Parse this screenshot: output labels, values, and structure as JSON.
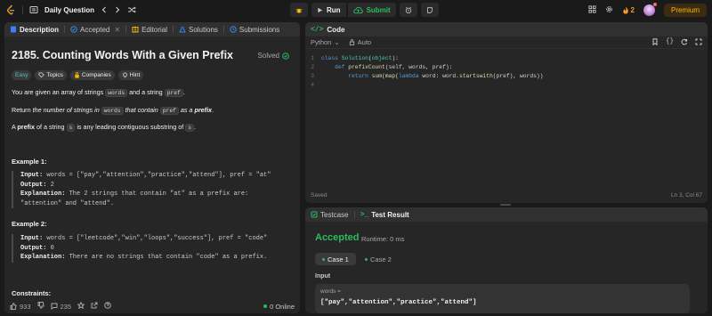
{
  "topbar": {
    "title": "Daily Question",
    "run_label": "Run",
    "submit_label": "Submit",
    "streak": "2",
    "premium_label": "Premium"
  },
  "left_tabs": {
    "description": "Description",
    "accepted": "Accepted",
    "editorial": "Editorial",
    "solutions": "Solutions",
    "submissions": "Submissions"
  },
  "problem": {
    "title": "2185. Counting Words With a Given Prefix",
    "status": "Solved",
    "tags": [
      "Easy",
      "Topics",
      "Companies",
      "Hint"
    ],
    "p1_a": "You are given an array of strings",
    "p1_code1": "words",
    "p1_b": "and a string",
    "p1_code2": "pref",
    "p1_c": ".",
    "p2_a": "Return",
    "p2_em": "the number of strings in",
    "p2_code1": "words",
    "p2_em2": "that contain",
    "p2_code2": "pref",
    "p2_em3": "as a",
    "p2_strong": "prefix",
    "p2_c": ".",
    "p3_a": "A",
    "p3_strong": "prefix",
    "p3_b": "of a string",
    "p3_code1": "s",
    "p3_c": "is any leading contiguous substring of",
    "p3_code2": "s",
    "p3_d": ".",
    "example1_title": "Example 1:",
    "example1_input": "words = [\"pay\",\"attention\",\"practice\",\"attend\"], pref = \"at\"",
    "example1_output": "2",
    "example1_explanation_1": "The 2 strings that contain \"at\" as a prefix are:",
    "example1_explanation_2": "\"attention\" and \"attend\".",
    "example2_title": "Example 2:",
    "example2_input": "words = [\"leetcode\",\"win\",\"loops\",\"success\"], pref = \"code\"",
    "example2_output": "0",
    "example2_explanation": "There are no strings that contain \"code\" as a prefix.",
    "constraints_title": "Constraints:"
  },
  "footer": {
    "likes": "933",
    "comments": "235",
    "online": "0 Online"
  },
  "code_panel": {
    "title": "Code",
    "language": "Python",
    "auto": "Auto",
    "lines": [
      "class Solution(object):",
      "    def prefixCount(self, words, pref):",
      "        return sum(map(lambda word: word.startswith(pref), words))",
      ""
    ],
    "line_numbers": [
      "1",
      "2",
      "3",
      "4"
    ],
    "saved": "Saved",
    "cursor": "Ln 3, Col 67"
  },
  "result_panel": {
    "testcase_tab": "Testcase",
    "result_tab": "Test Result",
    "status": "Accepted",
    "runtime": "Runtime: 0 ms",
    "case1": "Case 1",
    "case2": "Case 2",
    "input_label": "Input",
    "var_name": "words =",
    "var_value": "[\"pay\",\"attention\",\"practice\",\"attend\"]"
  },
  "colors": {
    "accent_green": "#2cbb5d",
    "premium": "#ffb800",
    "easy": "#46c6c2"
  }
}
